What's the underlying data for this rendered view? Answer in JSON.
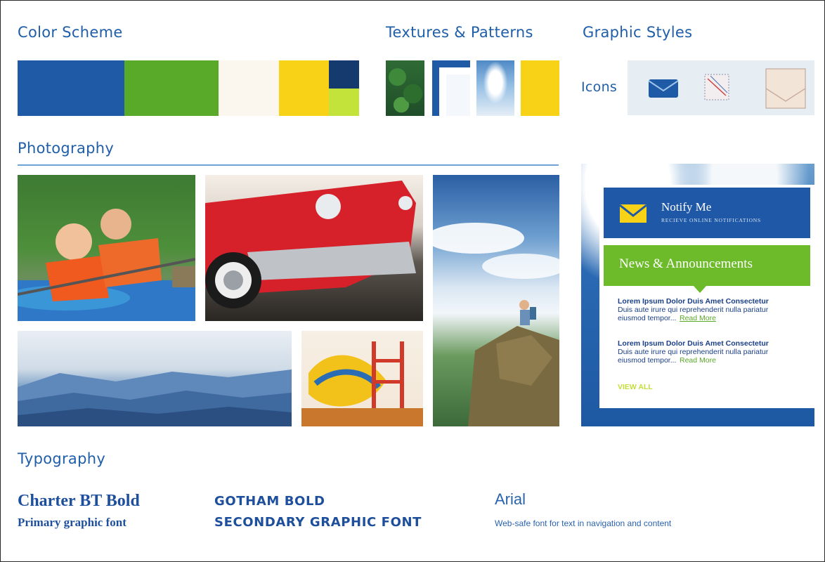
{
  "sections": {
    "color_scheme": "Color Scheme",
    "textures": "Textures & Patterns",
    "graphic_styles": "Graphic Styles",
    "photography": "Photography",
    "typography": "Typography"
  },
  "colors": {
    "blue": "#1e5aa6",
    "green": "#5aaa2a",
    "cream": "#fbf6ee",
    "yellow": "#f7d217",
    "navy": "#143a6e",
    "lime": "#c3e23a"
  },
  "graphic_styles": {
    "icons_label": "Icons",
    "icon_names": [
      "envelope-icon",
      "letter-sketch-icon",
      "envelope-paper-icon"
    ]
  },
  "photos": [
    "kids-kayaking-photo",
    "red-classic-car-photo",
    "sky-clouds-photo",
    "blue-mountains-photo",
    "playground-photo",
    "hiker-on-rock-photo"
  ],
  "widget": {
    "notify_title": "Notify Me",
    "notify_subtitle": "RECIEVE ONLINE NOTIFICATIONS",
    "news_title": "News & Announcements",
    "items": [
      {
        "title": "Lorem Ipsum Dolor Duis Amet Consectetur",
        "body1": "Duis aute irure qui reprehenderit nulla pariatur",
        "body2": "eiusmod tempor...",
        "more": "Read More"
      },
      {
        "title": "Lorem Ipsum Dolor Duis Amet Consectetur",
        "body1": "Duis aute irure qui reprehenderit nulla pariatur",
        "body2": "eiusmod tempor...",
        "more": "Read More"
      }
    ],
    "view_all": "VIEW ALL"
  },
  "typography": {
    "font1_name": "Charter BT Bold",
    "font1_desc": "Primary graphic font",
    "font2_name": "GOTHAM BOLD",
    "font2_desc": "SECONDARY GRAPHIC FONT",
    "font3_name": "Arial",
    "font3_desc": "Web-safe font for text in navigation and content"
  }
}
